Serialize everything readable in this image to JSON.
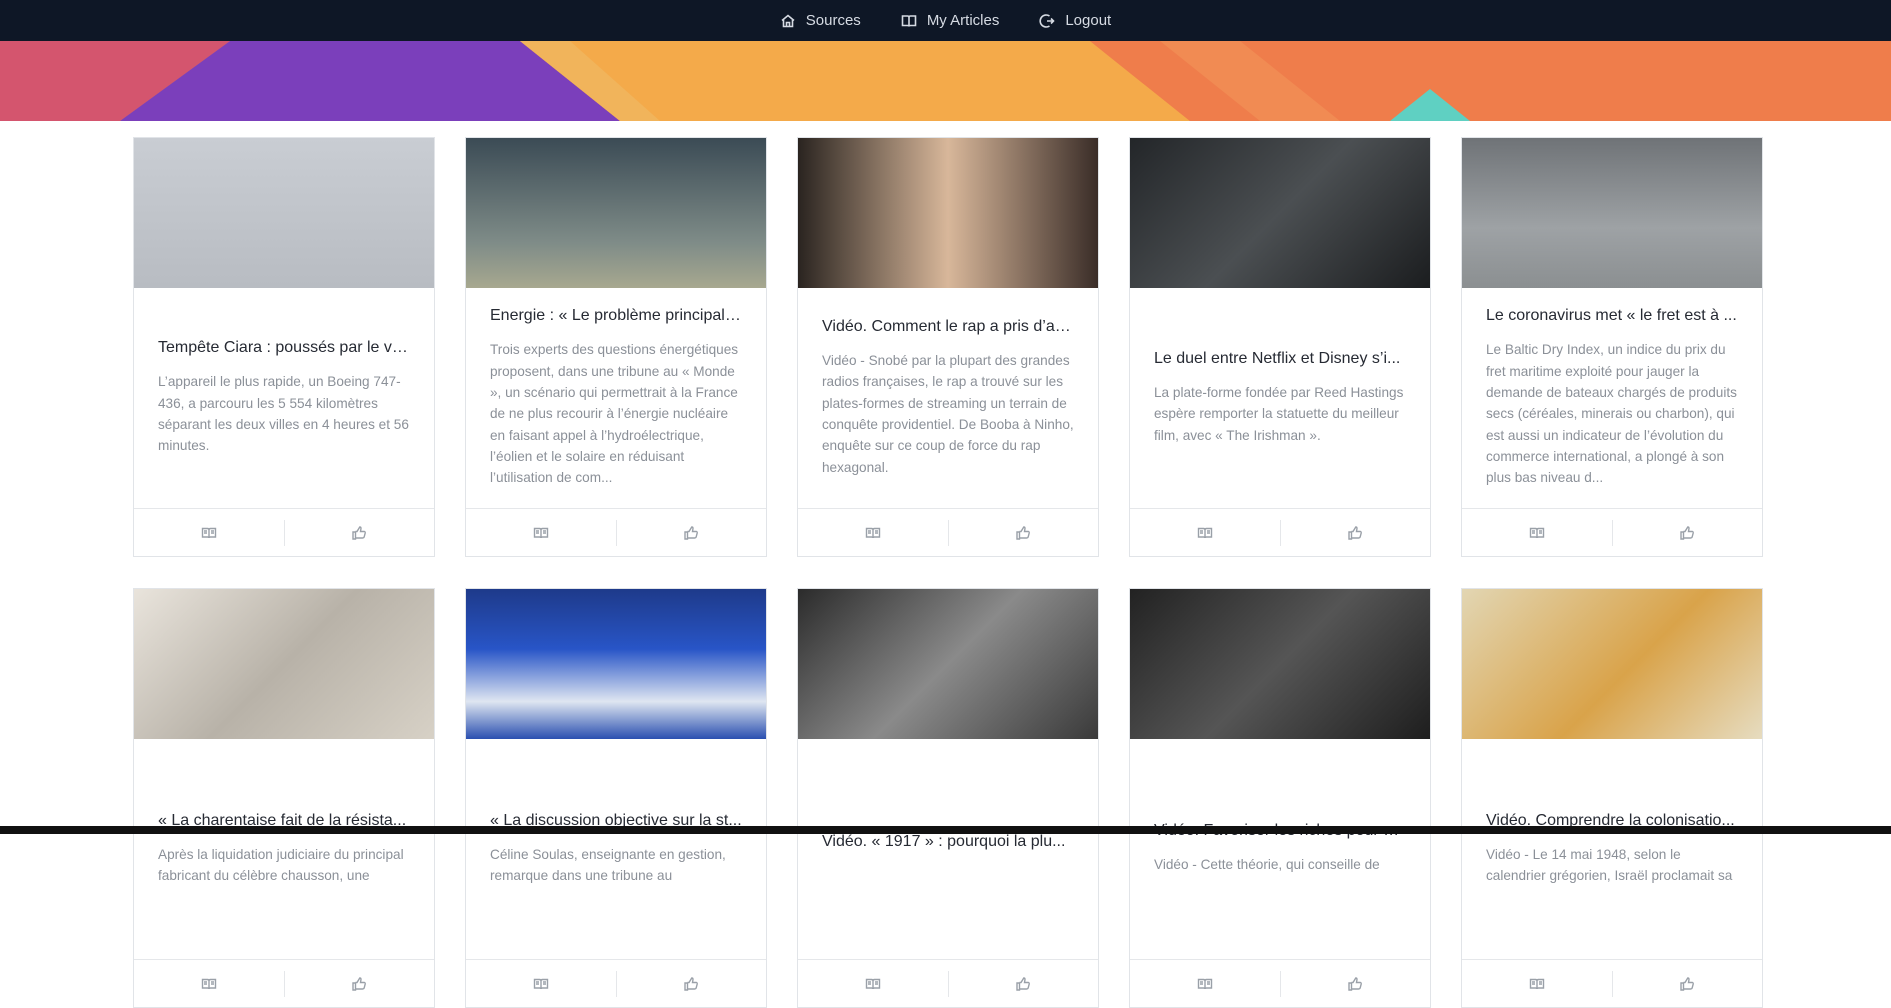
{
  "nav": {
    "items": [
      {
        "label": "Sources",
        "icon": "home-icon"
      },
      {
        "label": "My Articles",
        "icon": "book-icon"
      },
      {
        "label": "Logout",
        "icon": "logout-icon"
      }
    ]
  },
  "articles": [
    {
      "title": "Tempête Ciara : poussés par le ve...",
      "text": "L’appareil le plus rapide, un Boeing 747-436, a parcouru les 5 554 kilomètres séparant les deux villes en 4 heures et 56 minutes."
    },
    {
      "title": "Energie : « Le problème principal ...",
      "text": "Trois experts des questions énergétiques proposent, dans une tribune au « Monde », un scénario qui permettrait à la France de ne plus recourir à l’énergie nucléaire en faisant appel à l’hydroélectrique, l’éolien et le solaire en réduisant l’utilisation de com..."
    },
    {
      "title": "Vidéo. Comment le rap a pris d’as...",
      "text": "Vidéo - Snobé par la plupart des grandes radios françaises, le rap a trouvé sur les plates-formes de streaming un terrain de conquête providentiel. De Booba à Ninho, enquête sur ce coup de force du rap hexagonal."
    },
    {
      "title": "Le duel entre Netflix et Disney s’i...",
      "text": "La plate-forme fondée par Reed Hastings espère remporter la statuette du meilleur film, avec « The Irishman »."
    },
    {
      "title": "Le coronavirus met « le fret est à ...",
      "text": "Le Baltic Dry Index, un indice du prix du fret maritime exploité pour jauger la demande de bateaux chargés de produits secs (céréales, minerais ou charbon), qui est aussi un indicateur de l’évolution du commerce international, a plongé à son plus bas niveau d..."
    },
    {
      "title": "« La charentaise fait de la résista...",
      "text": "Après la liquidation judiciaire du principal fabricant du célèbre chausson, une"
    },
    {
      "title": "« La discussion objective sur la st...",
      "text": "Céline Soulas, enseignante en gestion, remarque dans une tribune au"
    },
    {
      "title": "Vidéo. « 1917 » : pourquoi la plu...",
      "text": ""
    },
    {
      "title": "Vidéo. Favoriser les riches pour ai...",
      "text": "Vidéo - Cette théorie, qui conseille de"
    },
    {
      "title": "Vidéo. Comprendre la colonisatio...",
      "text": "Vidéo - Le 14 mai 1948, selon le calendrier grégorien, Israël proclamait sa"
    }
  ],
  "colors": {
    "nav_bg": "#0e1726",
    "banner": [
      "#d4556e",
      "#7b3fbb",
      "#f4aa4a",
      "#ef7d4b",
      "#5fd0c2"
    ]
  }
}
